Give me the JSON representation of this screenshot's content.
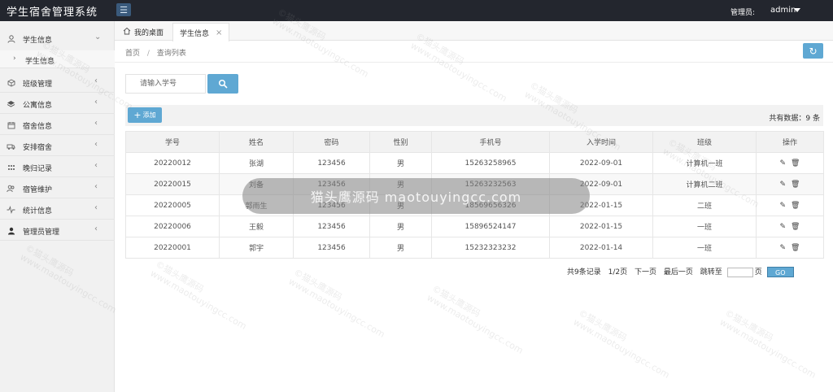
{
  "header": {
    "brand": "学生宿舍管理系统",
    "menu_icon": "hamburger-icon",
    "admin_label": "管理员:",
    "admin_name": "admin"
  },
  "sidebar": {
    "items": [
      {
        "label": "学生信息",
        "icon": "user-icon",
        "expanded": true
      },
      {
        "label": "班级管理",
        "icon": "cube-icon"
      },
      {
        "label": "公寓信息",
        "icon": "layers-icon"
      },
      {
        "label": "宿舍信息",
        "icon": "calendar-icon"
      },
      {
        "label": "安排宿舍",
        "icon": "truck-icon"
      },
      {
        "label": "晚归记录",
        "icon": "grid-icon"
      },
      {
        "label": "宿管维护",
        "icon": "group-icon"
      },
      {
        "label": "统计信息",
        "icon": "pulse-icon"
      },
      {
        "label": "管理员管理",
        "icon": "person-icon"
      }
    ],
    "sub_item": "学生信息"
  },
  "tabs": [
    {
      "label": "我的桌面",
      "icon": "home-icon"
    },
    {
      "label": "学生信息",
      "active": true
    }
  ],
  "breadcrumb": {
    "home": "首页",
    "current": "查询列表"
  },
  "search": {
    "placeholder": "请输入学号"
  },
  "toolbar": {
    "add_label": "添加",
    "total": "共有数据：9 条"
  },
  "table": {
    "headers": [
      "学号",
      "姓名",
      "密码",
      "性别",
      "手机号",
      "入学时间",
      "班级",
      "操作"
    ],
    "rows": [
      [
        "20220012",
        "张湖",
        "123456",
        "男",
        "15263258965",
        "2022-09-01",
        "计算机一班"
      ],
      [
        "20220015",
        "刘备",
        "123456",
        "男",
        "15263232563",
        "2022-09-01",
        "计算机二班"
      ],
      [
        "20220005",
        "郭雨生",
        "123456",
        "男",
        "18569656326",
        "2022-01-15",
        "二班"
      ],
      [
        "20220006",
        "王毅",
        "123456",
        "男",
        "15896524147",
        "2022-01-15",
        "一班"
      ],
      [
        "20220001",
        "郭宇",
        "123456",
        "男",
        "15232323232",
        "2022-01-14",
        "一班"
      ]
    ]
  },
  "pager": {
    "summary": "共9条记录",
    "page": "1/2页",
    "next": "下一页",
    "last": "最后一页",
    "jump": "跳转至",
    "unit": "页",
    "go": "GO"
  },
  "watermark": {
    "text_cn": "©猫头鹰源码",
    "text_en": "www.maotouyingcc.com",
    "center": "猫头鹰源码 maotouyingcc.com"
  },
  "colors": {
    "header": "#23262e",
    "accent": "#5fa8d3",
    "sidebar": "#f1f1f1"
  }
}
